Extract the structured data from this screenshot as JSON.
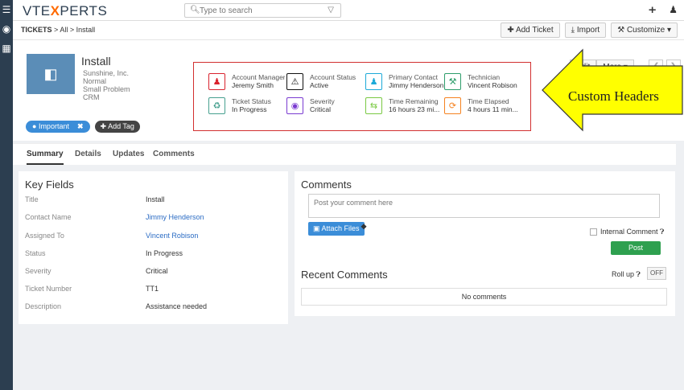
{
  "app": {
    "logo_pre": "VTE",
    "logo_x": "X",
    "logo_post": "PERTS"
  },
  "search": {
    "placeholder": "Type to search"
  },
  "breadcrumb": {
    "module": "TICKETS",
    "sep1": ">",
    "all": "All",
    "sep2": ">",
    "record": "Install"
  },
  "actions": {
    "add_ticket": "Add Ticket",
    "import": "Import",
    "customize": "Customize"
  },
  "record": {
    "title": "Install",
    "sub": [
      "Sunshine, Inc.",
      "Normal",
      "Small Problem",
      "CRM"
    ],
    "tag": "Important",
    "add_tag": "Add Tag",
    "edit": "Edit",
    "more": "More"
  },
  "header_fields": [
    {
      "label": "Account Manager",
      "value": "Jeremy Smith",
      "icon": "user-icon",
      "color": "#d9232e"
    },
    {
      "label": "Account Status",
      "value": "Active",
      "icon": "warning-icon",
      "color": "#111111"
    },
    {
      "label": "Primary Contact",
      "value": "Jimmy Henderson",
      "icon": "contact-icon",
      "color": "#1eaad8"
    },
    {
      "label": "Technician",
      "value": "Vincent Robison",
      "icon": "technician-icon",
      "color": "#2e9d6b"
    },
    {
      "label": "Ticket Status",
      "value": "In Progress",
      "icon": "recycle-icon",
      "color": "#47a08f"
    },
    {
      "label": "Severity",
      "value": "Critical",
      "icon": "eye-icon",
      "color": "#7a3bd1"
    },
    {
      "label": "Time Remaining",
      "value": "16 hours 23 mi...",
      "icon": "arrows-icon",
      "color": "#7ac943"
    },
    {
      "label": "Time Elapsed",
      "value": "4 hours 11 min...",
      "icon": "refresh-icon",
      "color": "#f58220"
    }
  ],
  "callout": {
    "text": "Custom Headers"
  },
  "tabs": [
    "Summary",
    "Details",
    "Updates",
    "Comments"
  ],
  "key_fields": {
    "title": "Key Fields",
    "rows": [
      {
        "k": "Title",
        "v": "Install"
      },
      {
        "k": "Contact Name",
        "v": "Jimmy Henderson"
      },
      {
        "k": "Assigned To",
        "v": "Vincent Robison"
      },
      {
        "k": "Status",
        "v": "In Progress"
      },
      {
        "k": "Severity",
        "v": "Critical"
      },
      {
        "k": "Ticket Number",
        "v": "TT1"
      },
      {
        "k": "Description",
        "v": "Assistance needed"
      }
    ]
  },
  "comments": {
    "title": "Comments",
    "placeholder": "Post your comment here",
    "attach": "Attach Files",
    "internal": "Internal Comment",
    "post": "Post",
    "recent": "Recent Comments",
    "rollup": "Roll up",
    "toggle": "OFF",
    "none": "No comments"
  }
}
